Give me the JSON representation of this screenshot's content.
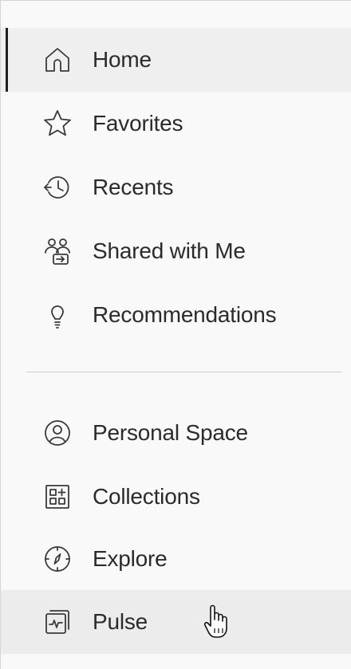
{
  "nav": {
    "primary": [
      {
        "label": "Home",
        "icon": "home-icon",
        "state": "selected"
      },
      {
        "label": "Favorites",
        "icon": "star-icon"
      },
      {
        "label": "Recents",
        "icon": "history-icon"
      },
      {
        "label": "Shared with Me",
        "icon": "shared-users-icon"
      },
      {
        "label": "Recommendations",
        "icon": "lightbulb-icon"
      }
    ],
    "secondary": [
      {
        "label": "Personal Space",
        "icon": "user-circle-icon"
      },
      {
        "label": "Collections",
        "icon": "collections-icon"
      },
      {
        "label": "Explore",
        "icon": "compass-icon"
      },
      {
        "label": "Pulse",
        "icon": "pulse-icon",
        "state": "hovered"
      }
    ]
  },
  "colors": {
    "text": "#2b2b2b",
    "icon": "#3a3a3a",
    "selected_bg": "#efefef",
    "selected_indicator": "#1f1f1f",
    "hover_bg": "#ececec",
    "panel_bg": "#f9f9f9",
    "divider": "#cfcfcf"
  }
}
